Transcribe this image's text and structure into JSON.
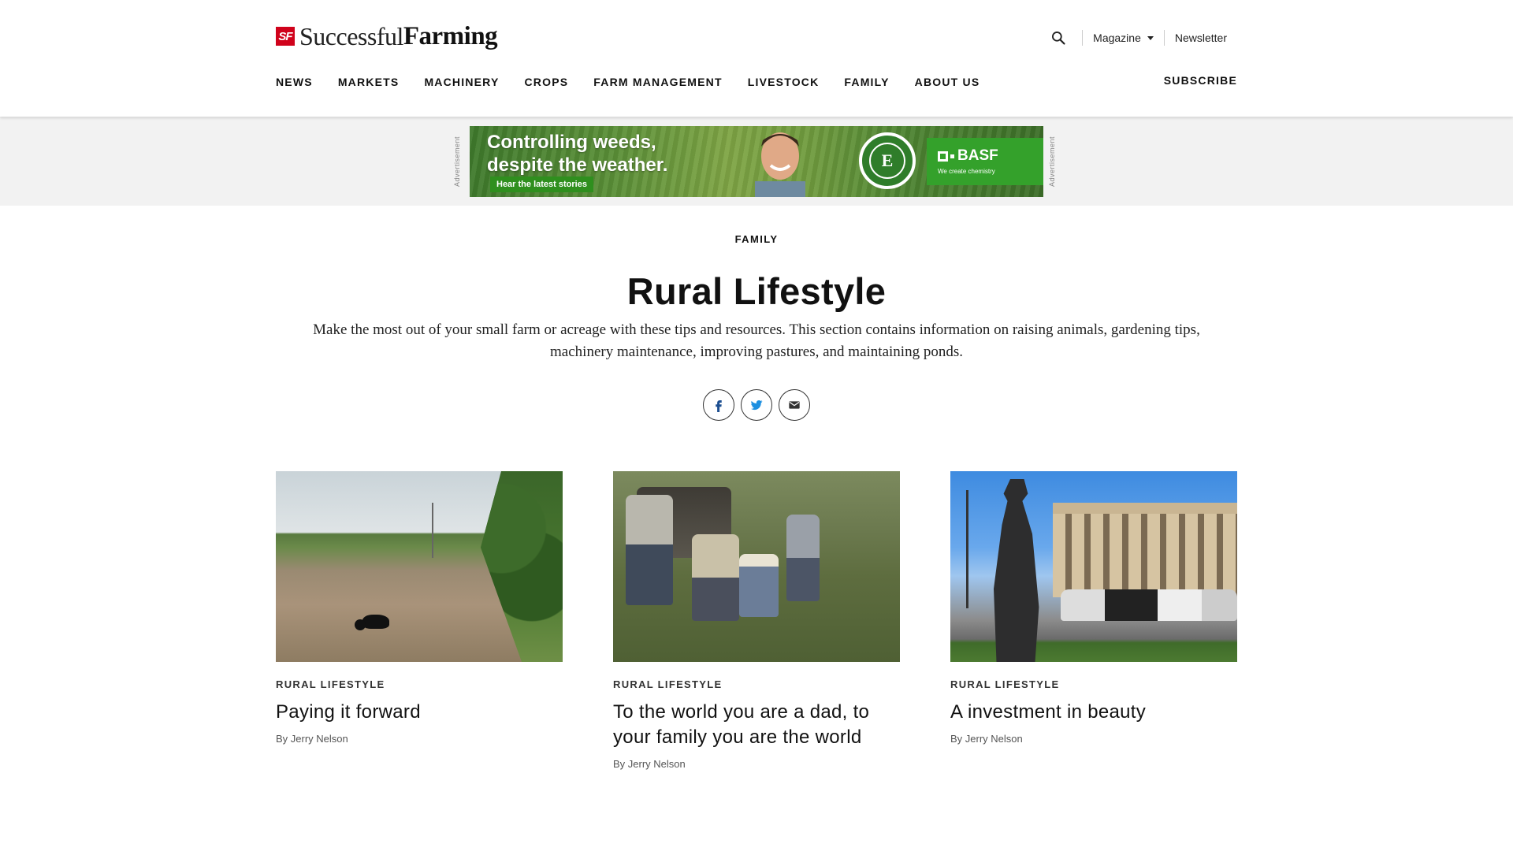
{
  "header": {
    "logo": {
      "badge": "SF",
      "word1": "Successful",
      "word2": "Farming"
    },
    "util": {
      "magazine_label": "Magazine",
      "newsletter_label": "Newsletter"
    },
    "nav": [
      "NEWS",
      "MARKETS",
      "MACHINERY",
      "CROPS",
      "FARM MANAGEMENT",
      "LIVESTOCK",
      "FAMILY",
      "ABOUT US"
    ],
    "subscribe_label": "SUBSCRIBE"
  },
  "ad": {
    "label": "Advertisement",
    "headline": "Controlling weeds, despite the weather.",
    "cta": "Hear the latest stories",
    "seal_letter": "E",
    "brand": "BASF",
    "brand_tagline": "We create chemistry"
  },
  "hero": {
    "eyebrow": "FAMILY",
    "title": "Rural Lifestyle",
    "description": "Make the most out of your small farm or acreage with these tips and resources. This section contains information on raising animals, gardening tips, machinery maintenance, improving pastures, and maintaining ponds."
  },
  "share": [
    "facebook-icon",
    "twitter-icon",
    "email-icon"
  ],
  "cards": [
    {
      "category": "RURAL LIFESTYLE",
      "title": "Paying it forward",
      "byline": "By Jerry Nelson"
    },
    {
      "category": "RURAL LIFESTYLE",
      "title": "To the world you are a dad, to your family you are the world",
      "byline": "By Jerry Nelson"
    },
    {
      "category": "RURAL LIFESTYLE",
      "title": "A investment in beauty",
      "byline": "By Jerry Nelson"
    }
  ],
  "colors": {
    "brand_red": "#d0021b",
    "ad_green": "#34a12b",
    "text": "#111111"
  }
}
